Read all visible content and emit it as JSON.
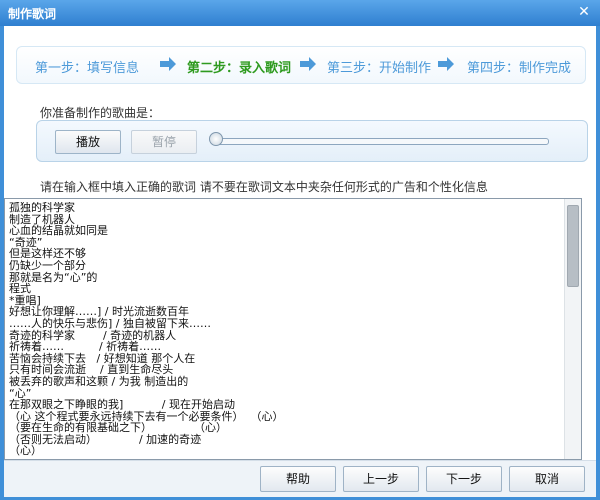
{
  "window": {
    "title": "制作歌词",
    "close_glyph": "✕"
  },
  "steps": [
    {
      "label": "第一步：填写信息",
      "active": false
    },
    {
      "label": "第二步：录入歌词",
      "active": true
    },
    {
      "label": "第三步：开始制作",
      "active": false
    },
    {
      "label": "第四步：制作完成",
      "active": false
    }
  ],
  "song_label": "你准备制作的歌曲是：",
  "player": {
    "play_label": "播放",
    "pause_label": "暂停",
    "progress": 0
  },
  "hint": "请在输入框中填入正确的歌词  请不要在歌词文本中夹杂任何形式的广告和个性化信息",
  "lyrics": "孤独的科学家\n制造了机器人\n心血的结晶就如同是\n“奇迹”\n但是这样还不够\n仍缺少一个部分\n那就是名为“心”的\n程式\n*重唱]\n好想让你理解……] / 时光流逝数百年\n……人的快乐与悲伤] / 独自被留下来……\n奇迹的科学家        / 奇迹的机器人\n祈祷着……          / 祈祷着……\n苦恼会持续下去   / 好想知道 那个人在\n只有时间会流逝    / 直到生命尽头\n被丢弃的歌声和这颗 / 为我 制造出的\n“心”\n在那双眼之下睁眼的我]           / 现在开始启动\n（心 这个程式要永远持续下去有一个必要条件）  （心）\n（要在生命的有限基础之下）            （心）\n（否则无法启动）            / 加速的奇迹\n（心）\n对你来说，我的存在是什么样子的？] / 为什么 眼泪会 停止不下来？",
  "buttons": {
    "help": "帮助",
    "prev": "上一步",
    "next": "下一步",
    "cancel": "取消"
  },
  "colors": {
    "title_bar": "#3f8fd8",
    "step_inactive": "#4d9ad9",
    "step_active": "#2e9a1f"
  }
}
